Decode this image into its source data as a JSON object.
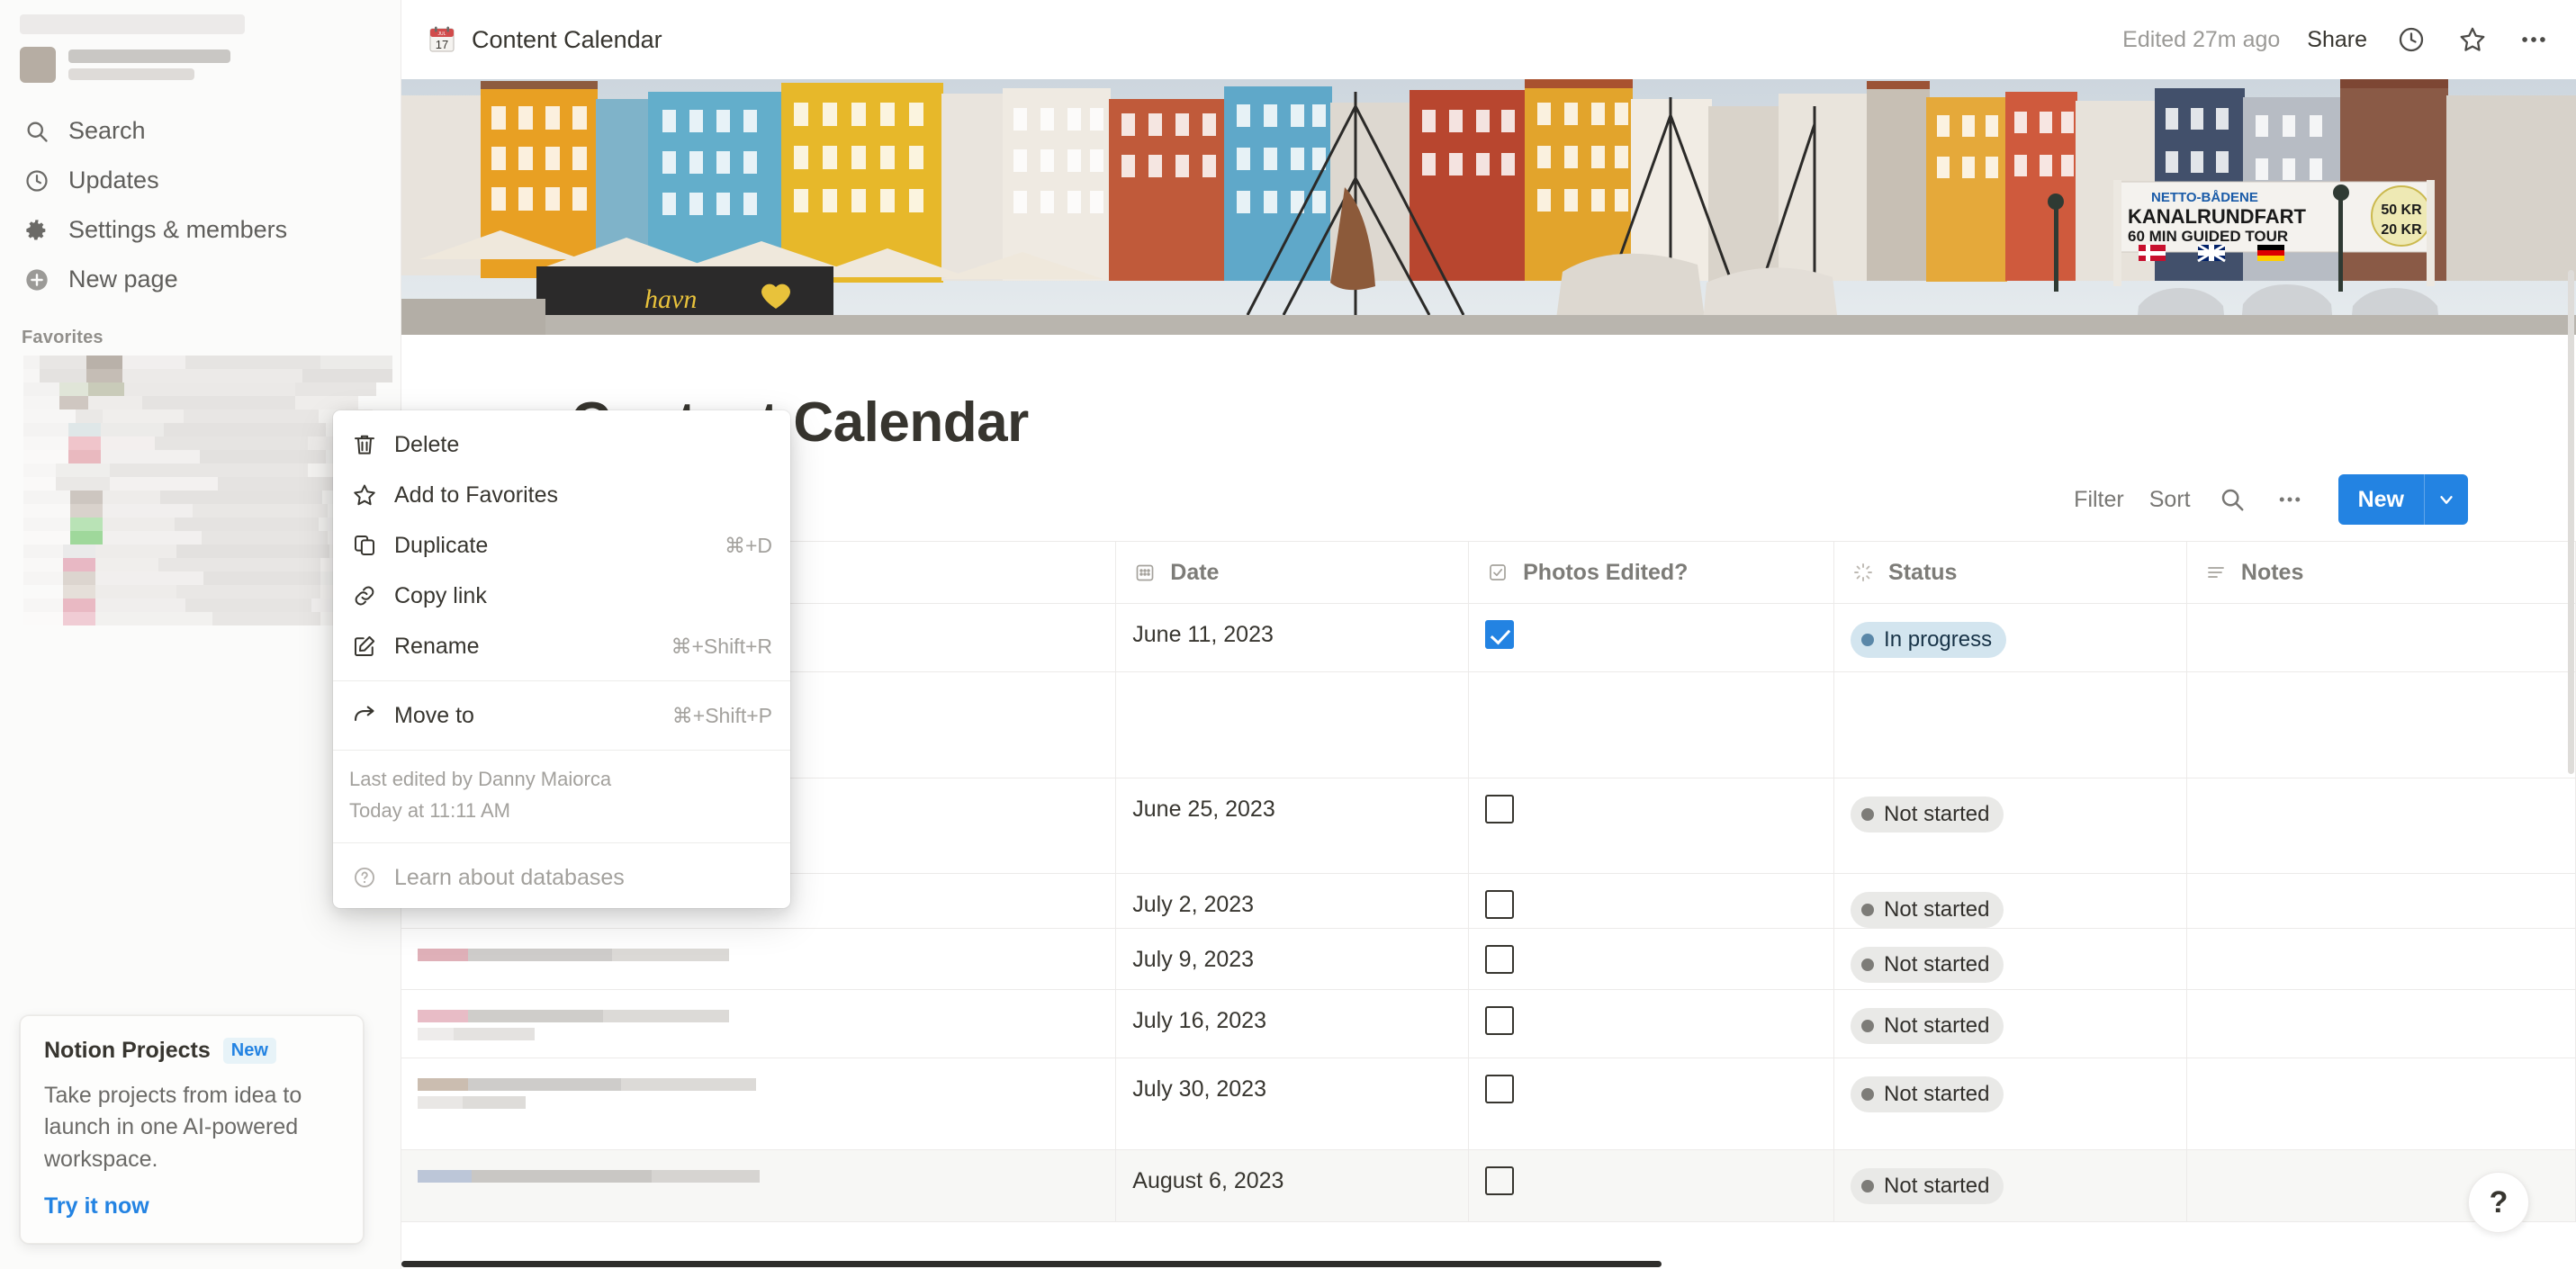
{
  "sidebar": {
    "nav_items": [
      {
        "label": "Search",
        "icon": "search-icon"
      },
      {
        "label": "Updates",
        "icon": "clock-icon"
      },
      {
        "label": "Settings & members",
        "icon": "gear-icon"
      },
      {
        "label": "New page",
        "icon": "plus-circle-icon"
      }
    ],
    "favorites_header": "Favorites",
    "promo": {
      "title": "Notion Projects",
      "badge": "New",
      "body": "Take projects from idea to launch in one AI-powered workspace.",
      "link": "Try it now"
    }
  },
  "topbar": {
    "breadcrumb_icon": "calendar-emoji",
    "breadcrumb_title": "Content Calendar",
    "edited": "Edited 27m ago",
    "share": "Share",
    "updates_icon": "clock-icon",
    "favorite_icon": "star-icon",
    "more_icon": "ellipsis-icon"
  },
  "page": {
    "title": "Content Calendar"
  },
  "db_toolbar": {
    "filter": "Filter",
    "sort": "Sort",
    "search_icon": "search-icon",
    "more_icon": "ellipsis-icon",
    "new_label": "New",
    "new_caret_icon": "chevron-down-icon"
  },
  "table": {
    "columns": [
      {
        "label": "",
        "icon": "title-icon"
      },
      {
        "label": "Date",
        "icon": "calendar-icon"
      },
      {
        "label": "Photos Edited?",
        "icon": "checkbox-icon"
      },
      {
        "label": "Status",
        "icon": "status-icon"
      },
      {
        "label": "Notes",
        "icon": "text-icon"
      }
    ],
    "rows": [
      {
        "name": "",
        "date": "June 11, 2023",
        "photos_edited": true,
        "status": "In progress",
        "status_kind": "inprogress",
        "notes": ""
      },
      {
        "name": "",
        "date": "",
        "photos_edited": null,
        "status": "",
        "status_kind": "",
        "notes": ""
      },
      {
        "name": "",
        "date": "June 25, 2023",
        "photos_edited": false,
        "status": "Not started",
        "status_kind": "notstarted",
        "notes": ""
      },
      {
        "name": "",
        "date": "July 2, 2023",
        "photos_edited": false,
        "status": "Not started",
        "status_kind": "notstarted",
        "notes": ""
      },
      {
        "name": "",
        "date": "July 9, 2023",
        "photos_edited": false,
        "status": "Not started",
        "status_kind": "notstarted",
        "notes": ""
      },
      {
        "name": "",
        "date": "July 16, 2023",
        "photos_edited": false,
        "status": "Not started",
        "status_kind": "notstarted",
        "notes": ""
      },
      {
        "name": "",
        "date": "July 30, 2023",
        "photos_edited": false,
        "status": "Not started",
        "status_kind": "notstarted",
        "notes": ""
      },
      {
        "name": "",
        "date": "August 6, 2023",
        "photos_edited": false,
        "status": "Not started",
        "status_kind": "notstarted",
        "notes": ""
      }
    ]
  },
  "context_menu": {
    "items": [
      {
        "label": "Delete",
        "shortcut": "",
        "icon": "trash-icon"
      },
      {
        "label": "Add to Favorites",
        "shortcut": "",
        "icon": "star-icon"
      },
      {
        "label": "Duplicate",
        "shortcut": "⌘+D",
        "icon": "duplicate-icon"
      },
      {
        "label": "Copy link",
        "shortcut": "",
        "icon": "link-icon"
      },
      {
        "label": "Rename",
        "shortcut": "⌘+Shift+R",
        "icon": "pencil-square-icon"
      }
    ],
    "move_to": {
      "label": "Move to",
      "shortcut": "⌘+Shift+P",
      "icon": "arrow-right-icon"
    },
    "meta_line1": "Last edited by Danny Maiorca",
    "meta_line2": "Today at 11:11 AM",
    "learn": {
      "label": "Learn about databases",
      "icon": "question-circle-icon"
    }
  },
  "help_button": {
    "label": "?"
  },
  "colors": {
    "accent": "#2383e2",
    "in_progress_bg": "#d3e5ef",
    "in_progress_dot": "#5a87a8",
    "not_started_bg": "#e9e9e7",
    "not_started_dot": "#7d7c78",
    "sidebar_bg": "#fbfbfa",
    "text": "#37352f"
  }
}
